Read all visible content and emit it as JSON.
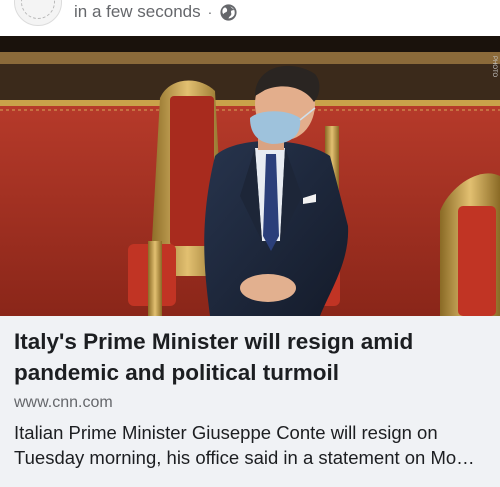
{
  "post": {
    "timestamp": "in a few seconds",
    "separator": "·",
    "privacy_icon": "globe-icon"
  },
  "link_preview": {
    "headline": "Italy's Prime Minister will resign amid pandemic and political turmoil",
    "domain": "www.cnn.com",
    "description": "Italian Prime Minister Giuseppe Conte will resign on Tuesday morning, his office said in a statement on Mo…"
  },
  "colors": {
    "meta_text": "#65676b",
    "headline_text": "#1c1e21",
    "preview_background": "#f0f2f5",
    "senate_red": "#a83224",
    "gilded_gold": "#c9a24a"
  }
}
